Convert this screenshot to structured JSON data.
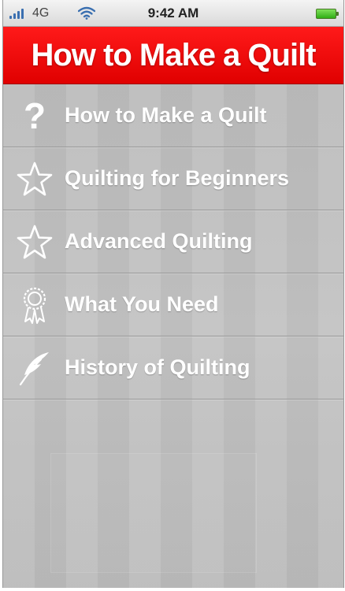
{
  "status_bar": {
    "network": "4G",
    "time": "9:42 AM"
  },
  "header": {
    "title": "How to Make a Quilt"
  },
  "menu": {
    "items": [
      {
        "label": "How to Make a Quilt",
        "icon": "question-mark-icon"
      },
      {
        "label": "Quilting for Beginners",
        "icon": "star-icon"
      },
      {
        "label": "Advanced Quilting",
        "icon": "star-icon"
      },
      {
        "label": "What You Need",
        "icon": "ribbon-badge-icon"
      },
      {
        "label": "History of Quilting",
        "icon": "feather-icon"
      }
    ]
  },
  "colors": {
    "header_red": "#ff0000",
    "menu_text": "#ffffff",
    "background_gray": "#bfbfbf",
    "battery_green": "#33b016"
  }
}
